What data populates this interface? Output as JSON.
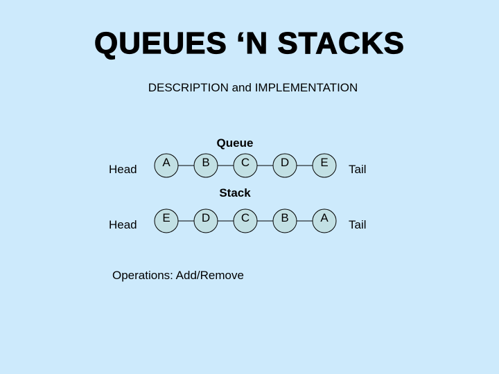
{
  "slide": {
    "title": "QUEUES ‘N STACKS",
    "subtitle": "DESCRIPTION and IMPLEMENTATION",
    "background_color": "#cdeafc",
    "node_fill_color": "#c2e0e4",
    "operations": "Operations: Add/Remove"
  },
  "queue": {
    "label": "Queue",
    "head_label": "Head",
    "tail_label": "Tail",
    "nodes": [
      "A",
      "B",
      "C",
      "D",
      "E"
    ]
  },
  "stack": {
    "label": "Stack",
    "head_label": "Head",
    "tail_label": "Tail",
    "nodes": [
      "E",
      "D",
      "C",
      "B",
      "A"
    ]
  }
}
